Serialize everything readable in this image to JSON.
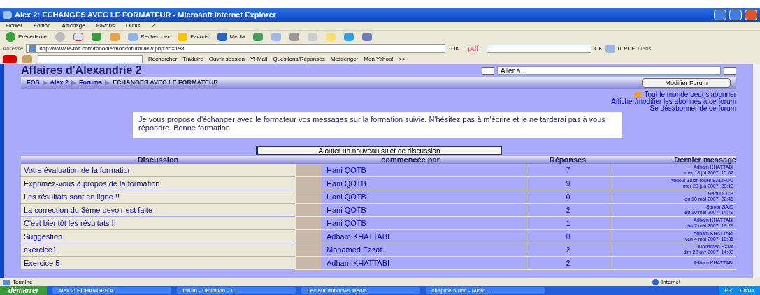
{
  "window": {
    "title": "Alex 2: ECHANGES AVEC LE FORMATEUR - Microsoft Internet Explorer"
  },
  "menu": [
    "Fichier",
    "Edition",
    "Affichage",
    "Favoris",
    "Outils",
    "?"
  ],
  "toolbar": {
    "back": "Précédente",
    "search": "Rechercher",
    "favorites": "Favoris",
    "media": "Média"
  },
  "address": {
    "label": "Adresse",
    "value": "http://www.le-fos.com/moodle/mod/forum/view.php?id=198",
    "go": "OK",
    "pdf": "pdf",
    "go2": "OK",
    "count": "0",
    "pdf2": "PDF",
    "links": "Liens"
  },
  "yahoo_bar": {
    "search": "Rechercher",
    "translate": "Traduire",
    "session": "Ouvrir session",
    "mail": "Y! Mail",
    "qa": "Questions/Réponses",
    "messenger": "Messenger",
    "myyahoo": "Mon Yahoo!",
    "more": ">>"
  },
  "page": {
    "title": "Affaires d'Alexandrie 2",
    "jump": "Aller à...",
    "breadcrumb": [
      {
        "label": "FOS",
        "link": true
      },
      {
        "label": "Alex 2",
        "link": true
      },
      {
        "label": "Forums",
        "link": true
      },
      {
        "label": "ECHANGES AVEC LE FORMATEUR",
        "link": false
      }
    ],
    "edit_button": "Modifier Forum",
    "links": [
      "Tout le monde peut s'abonner",
      "Afficher/modifier les abonnés à ce forum",
      "Se désabonner de ce forum"
    ],
    "intro": "Je vous propose d'échanger avec le formateur vos messages sur la formation suivie. N'hésitez pas à m'écrire et je ne tarderai pas à vous répondre. Bonne formation",
    "add_button": "Ajouter un nouveau sujet de discussion"
  },
  "table": {
    "columns": [
      "Discussion",
      "commencée par",
      "Réponses",
      "Dernier message"
    ],
    "rows": [
      {
        "topic": "Votre évaluation de la formation",
        "author": "Hani QOTB",
        "replies": "7",
        "last_by": "Adham KHATTABI",
        "last_date": "mer 18 jul 2007, 15:02"
      },
      {
        "topic": "Exprimez-vous à propos de la formation",
        "author": "Hani QOTB",
        "replies": "9",
        "last_by": "Abdoul Zakir Toure SALIFOU",
        "last_date": "mer 20 jun 2007, 20:13"
      },
      {
        "topic": "Les résultats sont en ligne !!",
        "author": "Hani QOTB",
        "replies": "0",
        "last_by": "Hani QOTB",
        "last_date": "jeu 10 mai 2007, 22:46"
      },
      {
        "topic": "La correction du 3ème devoir est faite",
        "author": "Hani QOTB",
        "replies": "2",
        "last_by": "Samar SAID",
        "last_date": "jeu 10 mai 2007, 14:49"
      },
      {
        "topic": "C'est bientôt les résultats !!",
        "author": "Hani QOTB",
        "replies": "1",
        "last_by": "Adham KHATTABI",
        "last_date": "lun 7 mai 2007, 19:29"
      },
      {
        "topic": "Suggestion",
        "author": "Adham KHATTABI",
        "replies": "0",
        "last_by": "Adham KHATTABI",
        "last_date": "ven 4 mai 2007, 10:36"
      },
      {
        "topic": "exercice1",
        "author": "Mohamed Ezzat",
        "replies": "2",
        "last_by": "Mohamed Ezzat",
        "last_date": "dim 22 avr 2007, 14:08"
      },
      {
        "topic": "Exercice 5",
        "author": "Adham KHATTABI",
        "replies": "2",
        "last_by": "Adham KHATTABI"
      }
    ]
  },
  "status_bar": {
    "text": "Terminé",
    "zone": "Internet"
  },
  "taskbar": {
    "start": "démarrer",
    "tasks": [
      "Alex 2: ECHANGES A...",
      "forum - Définition - T...",
      "Lecteur Windows Media",
      "chapitre 5.doc - Micro..."
    ],
    "lang": "FR",
    "clock": "08:04"
  }
}
